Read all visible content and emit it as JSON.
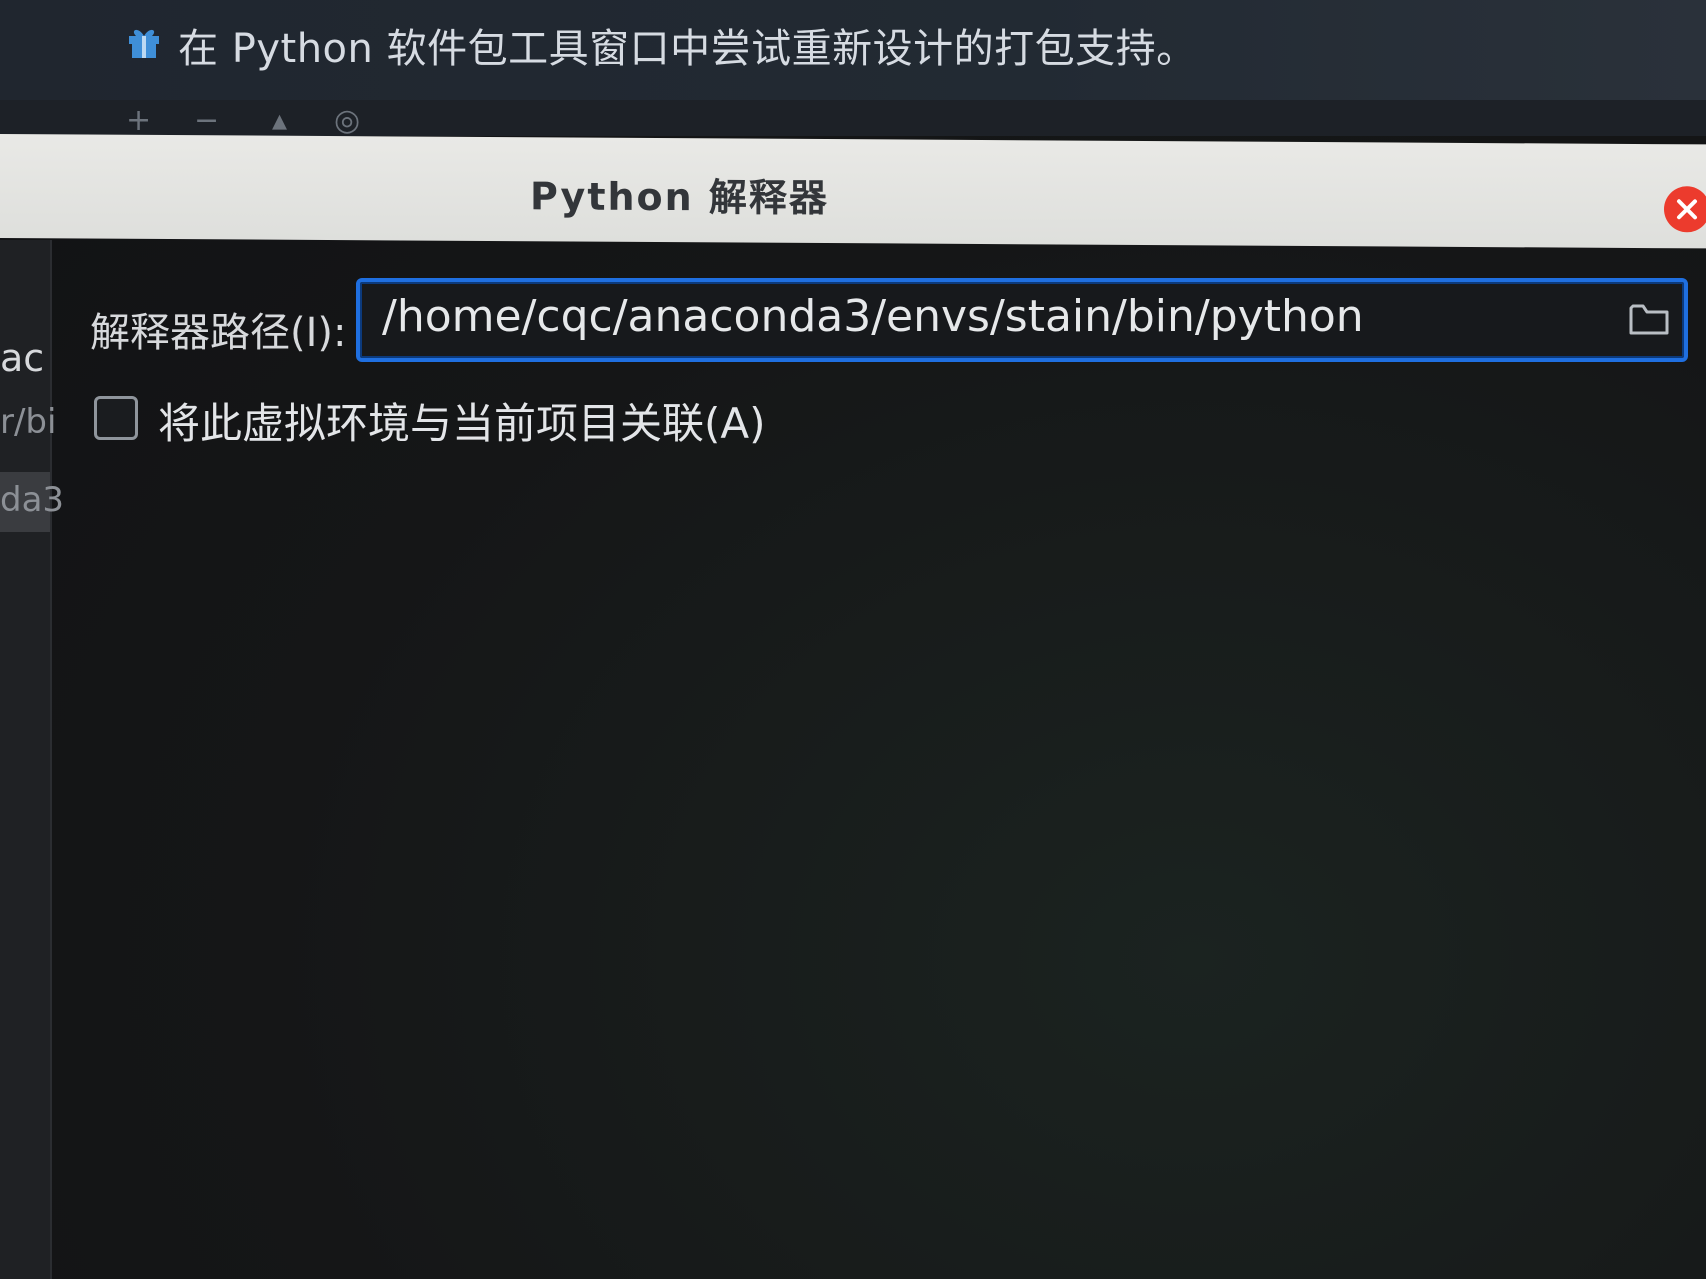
{
  "banner": {
    "icon": "gift-icon",
    "text": "在 Python 软件包工具窗口中尝试重新设计的打包支持。"
  },
  "background_list": {
    "fragments": [
      "ac",
      "r/bi",
      "da3"
    ]
  },
  "dialog": {
    "title": "Python 解释器",
    "close_icon": "close-icon",
    "interpreter_path_label": "解释器路径(I):",
    "interpreter_path_value": "/home/cqc/anaconda3/envs/stain/bin/python",
    "browse_icon": "folder-icon",
    "associate_checkbox_label": "将此虚拟环境与当前项目关联(A)",
    "associate_checked": false
  },
  "colors": {
    "focus_border": "#1f6fe0",
    "close_button": "#ec3b2d",
    "titlebar": "#e4e4e1",
    "dialog_background": "#151617"
  }
}
